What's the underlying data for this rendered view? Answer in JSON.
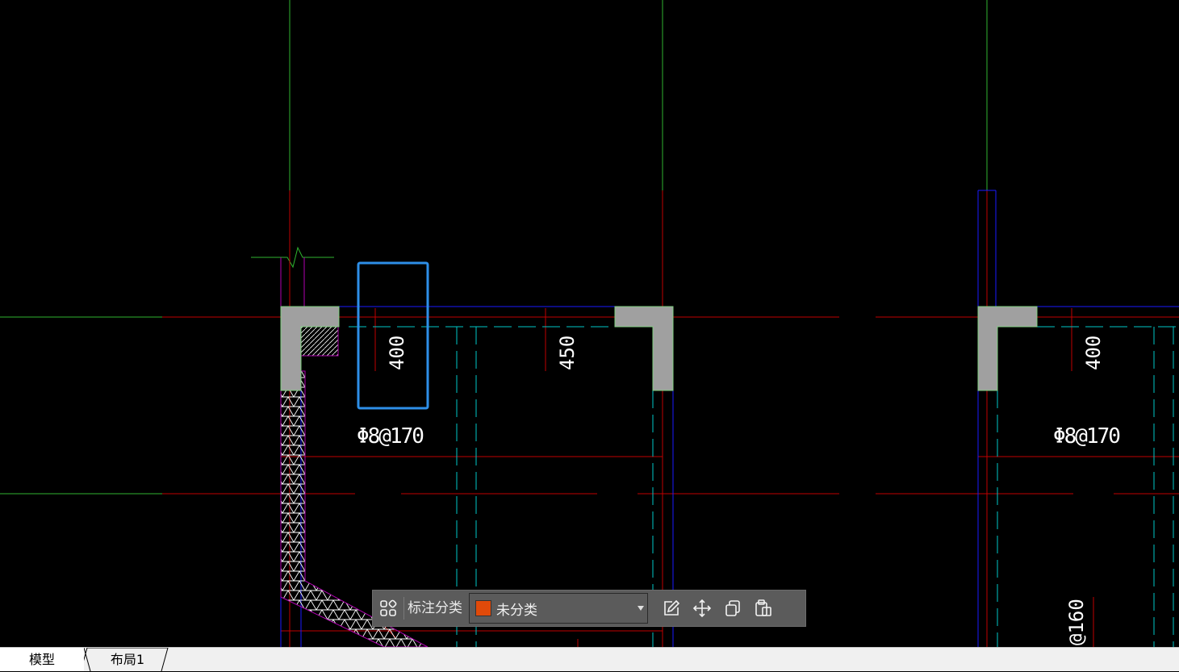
{
  "drawing": {
    "annotations": {
      "dim_400_a": "400",
      "dim_450": "450",
      "dim_400_b": "400",
      "rebar_a": "Φ8@170",
      "rebar_b": "Φ8@170",
      "rebar_c": "@160"
    },
    "colors": {
      "axis_red": "#c00000",
      "grid_green": "#2fb52f",
      "wall_blue": "#1a1aff",
      "dash_cyan": "#00c8c8",
      "hatch_magenta": "#b000b0",
      "column_gray": "#a0a0a0",
      "selection_blue": "#2e8fe8"
    }
  },
  "toolbar": {
    "label": "标注分类",
    "select_value": "未分类",
    "swatch_color": "#e04a0a",
    "icons": [
      "grid-apps-icon",
      "edit-icon",
      "move-icon",
      "copy-icon",
      "paste-icon"
    ]
  },
  "tabs": {
    "model": "模型",
    "layout1": "布局1"
  }
}
